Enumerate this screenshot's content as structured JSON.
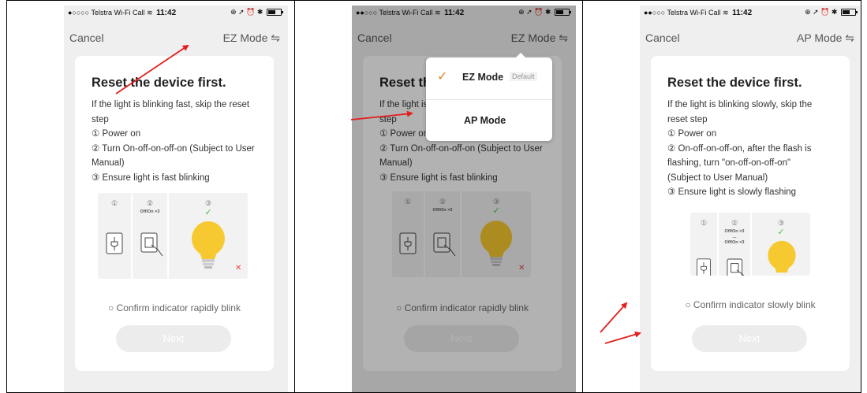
{
  "status_bar": {
    "carrier": "●○○○○ Telstra Wi-Fi Call",
    "carrier_p2": "●●○○○ Telstra Wi-Fi Call",
    "time": "11:42",
    "icons": "⊕ ➚ ⏰ ✱"
  },
  "panel1": {
    "cancel": "Cancel",
    "mode": "EZ Mode ⇋",
    "title": "Reset the device first.",
    "intro": "If the light is blinking fast, skip the reset step",
    "step1": "① Power on",
    "step2": "② Turn On-off-on-off-on (Subject to User Manual)",
    "step3": "③ Ensure light is fast blinking",
    "illus_num1": "①",
    "illus_num2": "②",
    "illus_num3": "③",
    "illus_offon": "Off/On ×3",
    "confirm": "○ Confirm indicator rapidly blink",
    "next": "Next"
  },
  "panel2": {
    "cancel": "Cancel",
    "mode": "EZ Mode ⇋",
    "title": "Reset the",
    "intro": "If the light is b",
    "step0": "step",
    "step1": "① Power on",
    "step2": "② Turn On-off-on-off-on (Subject to User Manual)",
    "step3": "③ Ensure light is fast blinking",
    "illus_num1": "①",
    "illus_num2": "②",
    "illus_num3": "③",
    "illus_offon": "Off/On ×3",
    "confirm": "○ Confirm indicator rapidly blink",
    "next": "Next",
    "dropdown": {
      "item1_check": "✓",
      "item1_label": "EZ Mode",
      "item1_badge": "Default",
      "item2_label": "AP Mode"
    }
  },
  "panel3": {
    "cancel": "Cancel",
    "mode": "AP Mode ⇋",
    "title": "Reset the device first.",
    "intro": "If the light is blinking slowly, skip the reset step",
    "step1": "① Power on",
    "step2": "② On-off-on-off-on, after the flash is flashing, turn \"on-off-on-off-on\" (Subject to User Manual)",
    "step3": "③ Ensure  light is slowly flashing",
    "illus_num1": "①",
    "illus_num2": "②",
    "illus_num3": "③",
    "illus_offon": "Off/On ×3\n…\nOff/On ×3",
    "confirm": "○ Confirm indicator slowly blink",
    "next": "Next"
  },
  "colors": {
    "accent_orange": "#e0821f",
    "check_green": "#4cbb49",
    "annotation_red": "#e41e1e",
    "bulb_yellow": "#f7c930"
  },
  "icons": [
    "plug-icon",
    "switch-hand-icon",
    "bulb-icon",
    "check-icon",
    "cross-icon",
    "swap-icon"
  ]
}
